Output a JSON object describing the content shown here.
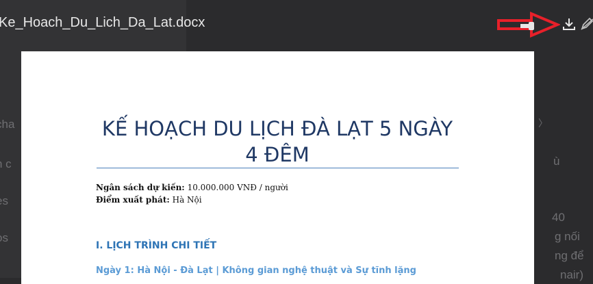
{
  "header": {
    "file_title": "Ke_Hoach_Du_Lich_Da_Lat.docx",
    "download_icon": "download-icon",
    "edit_icon": "pencil-icon"
  },
  "background": {
    "left_fragments": [
      "t",
      "cha",
      "h c",
      "es",
      "os"
    ],
    "right_fragments": [
      "ù",
      "40",
      "g nối",
      "ng để",
      "nair)"
    ]
  },
  "document": {
    "title": "KẾ HOẠCH DU LỊCH ĐÀ LẠT 5 NGÀY 4 ĐÊM",
    "budget_label": "Ngân sách dự kiến:",
    "budget_value": "10.000.000 VNĐ / người",
    "origin_label": "Điểm xuất phát:",
    "origin_value": "Hà Nội",
    "section_heading": "I. LỊCH TRÌNH CHI TIẾT",
    "day1_heading": "Ngày 1: Hà Nội - Đà Lạt | Không gian nghệ thuật và Sự tĩnh lặng"
  },
  "colors": {
    "annotation_arrow": "#e8202a",
    "title": "#1f3864",
    "section_heading": "#2e74b5",
    "day_heading": "#5b9bd5"
  }
}
